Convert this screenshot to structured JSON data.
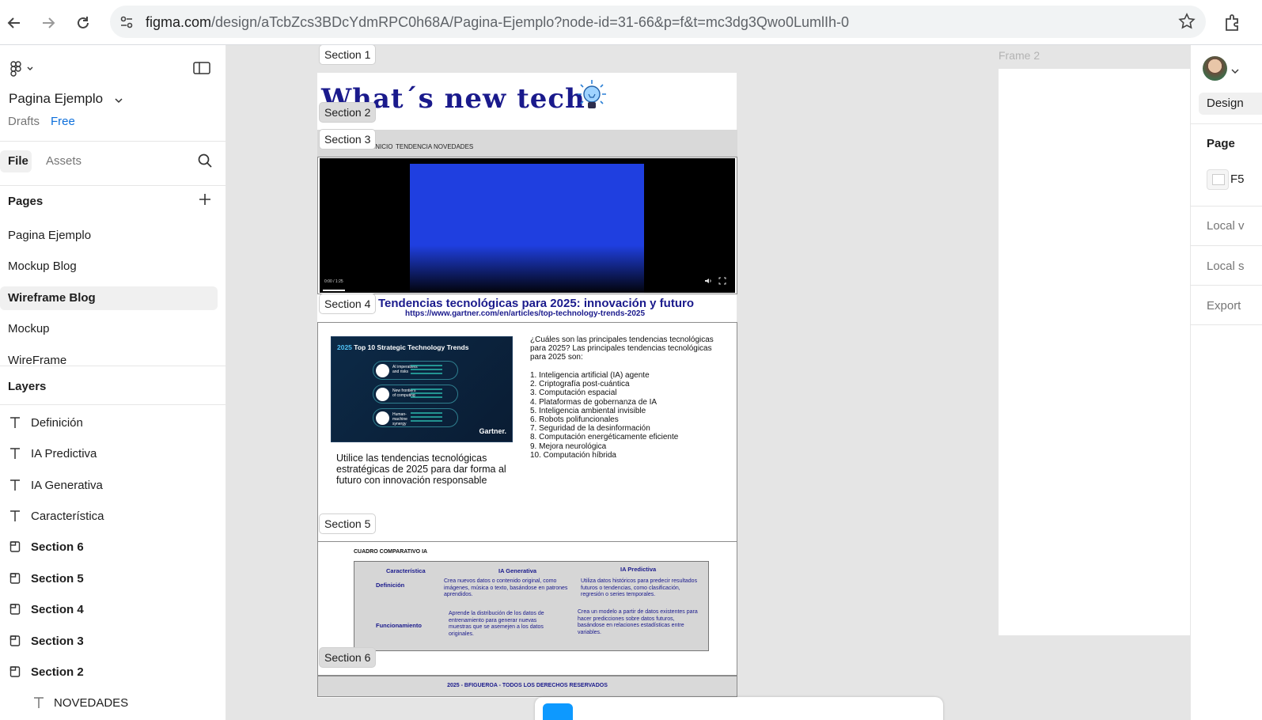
{
  "browser": {
    "url_domain": "figma.com",
    "url_path": "/design/aTcbZcs3BDcYdmRPC0h68A/Pagina-Ejemplo?node-id=31-66&p=f&t=mc3dg3Qwo0LumlIh-0"
  },
  "left_panel": {
    "file_name": "Pagina Ejemplo",
    "drafts": "Drafts",
    "plan": "Free",
    "tabs": {
      "file": "File",
      "assets": "Assets"
    },
    "pages_heading": "Pages",
    "pages": [
      {
        "label": "Pagina Ejemplo"
      },
      {
        "label": "Mockup Blog"
      },
      {
        "label": "Wireframe Blog"
      },
      {
        "label": "Mockup"
      },
      {
        "label": "WireFrame"
      }
    ],
    "layers_heading": "Layers",
    "layers": [
      {
        "label": "Definición",
        "type": "text"
      },
      {
        "label": "IA Predictiva",
        "type": "text"
      },
      {
        "label": "IA Generativa",
        "type": "text"
      },
      {
        "label": "Característica",
        "type": "text"
      },
      {
        "label": "Section 6",
        "type": "section"
      },
      {
        "label": "Section 5",
        "type": "section"
      },
      {
        "label": "Section 4",
        "type": "section"
      },
      {
        "label": "Section 3",
        "type": "section"
      },
      {
        "label": "Section 2",
        "type": "section"
      },
      {
        "label": "NOVEDADES",
        "type": "text"
      }
    ]
  },
  "canvas": {
    "sections": {
      "s1": "Section 1",
      "s2": "Section 2",
      "s3": "Section 3",
      "s4": "Section 4",
      "s5": "Section 5",
      "s6": "Section 6"
    },
    "hero_title": "What´s new tech?",
    "nav_links": [
      "INICIO",
      "TENDENCIA",
      "NOVEDADES"
    ],
    "video_time": "0:00 / 1:25",
    "s4_title": "Tendencias tecnológicas para 2025: innovación y futuro",
    "s4_url": "https://www.gartner.com/en/articles/top-technology-trends-2025",
    "gartner": {
      "year": "2025",
      "title": "Top 10 Strategic Technology Trends",
      "rows": [
        "AI imperatives and risks",
        "New frontiers of computing",
        "Human-machine synergy"
      ],
      "brand": "Gartner."
    },
    "s4_caption": "Utilice las tendencias tecnológicas estratégicas de 2025 para dar forma al futuro con innovación responsable",
    "s4_question": "¿Cuáles son las principales tendencias tecnológicas para 2025? Las principales tendencias tecnológicas para 2025 son:",
    "trends": [
      "1.  Inteligencia artificial (IA) agente",
      "2. Criptografía post-cuántica",
      "3. Computación espacial",
      "4. Plataformas de gobernanza de IA",
      "5. Inteligencia ambiental invisible",
      "6. Robots polifuncionales",
      "7. Seguridad de la desinformación",
      "8. Computación energéticamente eficiente",
      "9. Mejora neurológica",
      "10. Computación híbrida"
    ],
    "comparison": {
      "heading": "CUADRO COMPARATIVO IA",
      "headers": [
        "Característica",
        "IA Generativa",
        "IA Predictiva"
      ],
      "rows": [
        {
          "label": "Definición",
          "gen": "Crea nuevos datos o contenido original, como imágenes, música o texto, basándose en patrones aprendidos.",
          "pred": "Utiliza datos históricos para predecir resultados futuros o tendencias, como clasificación, regresión o series temporales."
        },
        {
          "label": "Funcionamiento",
          "gen": "Aprende la distribución de los datos de entrenamiento para generar nuevas muestras que se asemejen a los datos originales.",
          "pred": "Crea un modelo a partir de datos existentes para hacer predicciones sobre datos futuros, basándose en relaciones estadísticas entre variables."
        }
      ]
    },
    "footer": "2025 - BFIGUEROA - TODOS LOS DERECHOS RESERVADOS",
    "frame2_label": "Frame 2"
  },
  "right_panel": {
    "tab": "Design",
    "page_heading": "Page",
    "swatch_text": "F5",
    "local_variables": "Local v",
    "local_styles": "Local s",
    "export": "Export"
  }
}
